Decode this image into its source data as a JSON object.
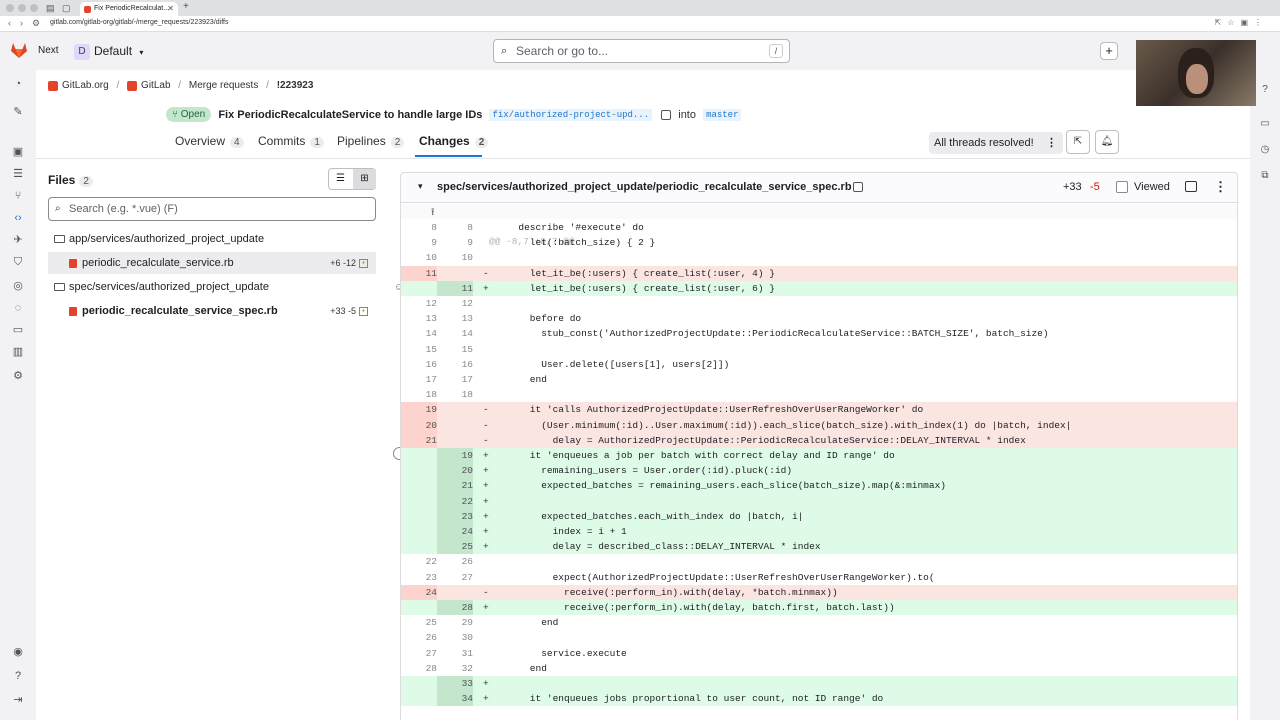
{
  "browser": {
    "tab_title": "Fix PeriodicRecalculat...",
    "url": "gitlab.com/gitlab-org/gitlab/-/merge_requests/223923/diffs"
  },
  "topbar": {
    "next_label": "Next",
    "context_initial": "D",
    "context_label": "Default",
    "search_placeholder": "Search or go to...",
    "search_shortcut": "/"
  },
  "breadcrumb": {
    "items": [
      "GitLab.org",
      "GitLab",
      "Merge requests",
      "!223923"
    ]
  },
  "mr": {
    "status": "Open",
    "title": "Fix PeriodicRecalculateService to handle large IDs",
    "source_branch": "fix/authorized-project-upd...",
    "into_label": "into",
    "target_branch": "master"
  },
  "tabs": [
    {
      "label": "Overview",
      "count": "4"
    },
    {
      "label": "Commits",
      "count": "1"
    },
    {
      "label": "Pipelines",
      "count": "2"
    },
    {
      "label": "Changes",
      "count": "2"
    }
  ],
  "threads_label": "All threads resolved!",
  "files": {
    "label": "Files",
    "count": "2",
    "search_placeholder": "Search (e.g. *.vue) (F)",
    "tree": [
      {
        "type": "folder",
        "name": "app/services/authorized_project_update"
      },
      {
        "type": "file",
        "name": "periodic_recalculate_service.rb",
        "added": "+6",
        "removed": "-12",
        "selected": true
      },
      {
        "type": "folder",
        "name": "spec/services/authorized_project_update"
      },
      {
        "type": "file",
        "name": "periodic_recalculate_service_spec.rb",
        "added": "+33",
        "removed": "-5",
        "selected": false
      }
    ]
  },
  "diff": {
    "path": "spec/services/authorized_project_update/periodic_recalculate_service_spec.rb",
    "added": "+33",
    "removed": "-5",
    "viewed_label": "Viewed",
    "hunk_header": "@@ -8,7 +8,7 @@",
    "lines": [
      {
        "t": "ctx",
        "o": "8",
        "n": "8",
        "c": "  describe '#execute' do"
      },
      {
        "t": "ctx",
        "o": "9",
        "n": "9",
        "c": "    let(:batch_size) { 2 }"
      },
      {
        "t": "ctx",
        "o": "10",
        "n": "10",
        "c": ""
      },
      {
        "t": "del",
        "o": "11",
        "n": "",
        "c": "    let_it_be(:users) { create_list(:user, 4) }"
      },
      {
        "t": "add",
        "o": "",
        "n": "11",
        "c": "    let_it_be(:users) { create_list(:user, 6) }"
      },
      {
        "t": "ctx",
        "o": "12",
        "n": "12",
        "c": ""
      },
      {
        "t": "ctx",
        "o": "13",
        "n": "13",
        "c": "    before do"
      },
      {
        "t": "ctx",
        "o": "14",
        "n": "14",
        "c": "      stub_const('AuthorizedProjectUpdate::PeriodicRecalculateService::BATCH_SIZE', batch_size)"
      },
      {
        "t": "ctx",
        "o": "15",
        "n": "15",
        "c": ""
      },
      {
        "t": "ctx",
        "o": "16",
        "n": "16",
        "c": "      User.delete([users[1], users[2]])"
      },
      {
        "t": "ctx",
        "o": "17",
        "n": "17",
        "c": "    end"
      },
      {
        "t": "ctx",
        "o": "18",
        "n": "18",
        "c": ""
      },
      {
        "t": "del",
        "o": "19",
        "n": "",
        "c": "    it 'calls AuthorizedProjectUpdate::UserRefreshOverUserRangeWorker' do"
      },
      {
        "t": "del",
        "o": "20",
        "n": "",
        "c": "      (User.minimum(:id)..User.maximum(:id)).each_slice(batch_size).with_index(1) do |batch, index|"
      },
      {
        "t": "del",
        "o": "21",
        "n": "",
        "c": "        delay = AuthorizedProjectUpdate::PeriodicRecalculateService::DELAY_INTERVAL * index"
      },
      {
        "t": "add",
        "o": "",
        "n": "19",
        "c": "    it 'enqueues a job per batch with correct delay and ID range' do"
      },
      {
        "t": "add",
        "o": "",
        "n": "20",
        "c": "      remaining_users = User.order(:id).pluck(:id)"
      },
      {
        "t": "add",
        "o": "",
        "n": "21",
        "c": "      expected_batches = remaining_users.each_slice(batch_size).map(&:minmax)"
      },
      {
        "t": "add",
        "o": "",
        "n": "22",
        "c": ""
      },
      {
        "t": "add",
        "o": "",
        "n": "23",
        "c": "      expected_batches.each_with_index do |batch, i|"
      },
      {
        "t": "add",
        "o": "",
        "n": "24",
        "c": "        index = i + 1"
      },
      {
        "t": "add",
        "o": "",
        "n": "25",
        "c": "        delay = described_class::DELAY_INTERVAL * index"
      },
      {
        "t": "ctx",
        "o": "22",
        "n": "26",
        "c": ""
      },
      {
        "t": "ctx",
        "o": "23",
        "n": "27",
        "c": "        expect(AuthorizedProjectUpdate::UserRefreshOverUserRangeWorker).to("
      },
      {
        "t": "del",
        "o": "24",
        "n": "",
        "c": "          receive(:perform_in).with(delay, *batch.minmax))"
      },
      {
        "t": "add",
        "o": "",
        "n": "28",
        "c": "          receive(:perform_in).with(delay, batch.first, batch.last))"
      },
      {
        "t": "ctx",
        "o": "25",
        "n": "29",
        "c": "      end"
      },
      {
        "t": "ctx",
        "o": "26",
        "n": "30",
        "c": ""
      },
      {
        "t": "ctx",
        "o": "27",
        "n": "31",
        "c": "      service.execute"
      },
      {
        "t": "ctx",
        "o": "28",
        "n": "32",
        "c": "    end"
      },
      {
        "t": "add",
        "o": "",
        "n": "33",
        "c": ""
      },
      {
        "t": "add",
        "o": "",
        "n": "34",
        "c": "    it 'enqueues jobs proportional to user count, not ID range' do"
      }
    ]
  },
  "colors": {
    "accent": "#1f75cb",
    "gitlab_orange": "#e24329",
    "added_bg": "#ddfbe6",
    "removed_bg": "#fbe5e1"
  }
}
